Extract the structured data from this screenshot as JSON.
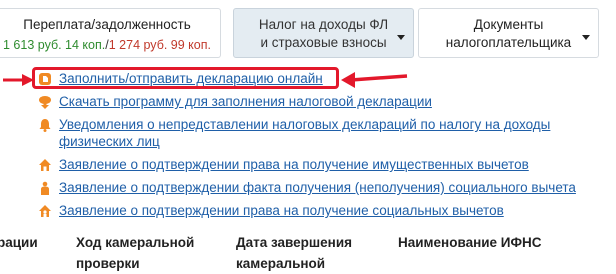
{
  "tabs": {
    "overpayment": {
      "title": "Переплата/задолженность",
      "amount_green": "1 613 руб. 14 коп.",
      "separator": "/",
      "amount_red": "1 274 руб. 99 коп."
    },
    "ndfl": {
      "line1": "Налог на доходы ФЛ",
      "line2": "и страховые взносы"
    },
    "documents": {
      "line1": "Документы",
      "line2": "налогоплательщика"
    }
  },
  "links": [
    {
      "label": "Заполнить/отправить декларацию онлайн",
      "icon": "declaration-icon"
    },
    {
      "label": "Скачать программу для заполнения налоговой декларации",
      "icon": "download-icon"
    },
    {
      "label_line1": "Уведомления о непредставлении налоговых деклараций по налогу на доходы",
      "label_line2": "физических лиц",
      "icon": "bell-icon"
    },
    {
      "label": "Заявление о подтверждении права на получение имущественных вычетов",
      "icon": "house-icon"
    },
    {
      "label": "Заявление о подтверждении факта получения (неполучения) социального вычета",
      "icon": "person-icon"
    },
    {
      "label": "Заявление о подтверждении права на получение социальных вычетов",
      "icon": "family-icon"
    }
  ],
  "table_headers": {
    "col1": "рации",
    "col2_line1": "Ход камеральной",
    "col2_line2": "проверки",
    "col3_line1": "Дата завершения",
    "col3_line2": "камеральной",
    "col4": "Наименование ИФНС"
  },
  "colors": {
    "link": "#1f5fa8",
    "highlight": "#e3182b",
    "icon_orange": "#f08a24",
    "amount_green": "#2f8c2f",
    "amount_red": "#c0392b",
    "active_tab": "#e4ecf2"
  }
}
